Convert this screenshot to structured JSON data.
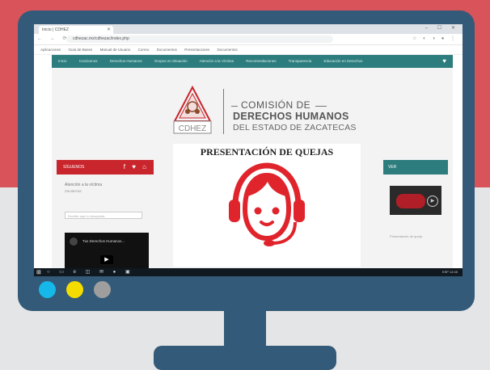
{
  "colors": {
    "background_top": "#d8545a",
    "background_bottom": "#e4e5e7",
    "monitor": "#335a78",
    "site_nav": "#2e7d7e",
    "accent_red": "#e0242c",
    "dot_cyan": "#15b8e8",
    "dot_yellow": "#f4dc00",
    "dot_grey": "#9e9e9e"
  },
  "browser": {
    "tab_title": "Inicio | CDHEZ",
    "url": "cdhezac.mx/cdhezac/index.php",
    "window_controls": "– ☐ ✕",
    "nav_icons": "← → ⟳",
    "ext_icons": "☆ ◐ ◑ ● ⋮",
    "bookmarks": [
      "Aplicaciones",
      "Guía de Bases",
      "Manual de Usuario",
      "Correo",
      "Documentos",
      "Presentaciones",
      "Documentos"
    ]
  },
  "site": {
    "nav_items": [
      "Inicio",
      "Conócenos",
      "Derechos Humanos",
      "Grupos en Situación",
      "Atención a la Víctima",
      "Recomendaciones",
      "Transparencia",
      "Educación en Derechos"
    ],
    "logo_acronym": "CDHEZ",
    "logo_line1": "COMISIÓN DE",
    "logo_line2": "DERECHOS HUMANOS",
    "logo_line3": "DEL ESTADO DE ZACATECAS",
    "left_panel_title": "SÍGUENOS",
    "left_panel_social": "f ♥ ⌂",
    "left_text1": "Atención a la víctima",
    "left_text2": "Zacatecas",
    "left_input_placeholder": "Escribe aquí tu búsqueda",
    "video_title": "Tus Derechos Humanos...",
    "right_panel_title": "VER",
    "right_text": "Presentación de queja"
  },
  "popup": {
    "title": "PRESENTACIÓN DE QUEJAS",
    "icon": "headset-agent-icon"
  },
  "taskbar": {
    "start": "⊞",
    "icons": "○ ▭ e ◫ ✉ ● ▣",
    "tray": "ESP 12:45"
  }
}
